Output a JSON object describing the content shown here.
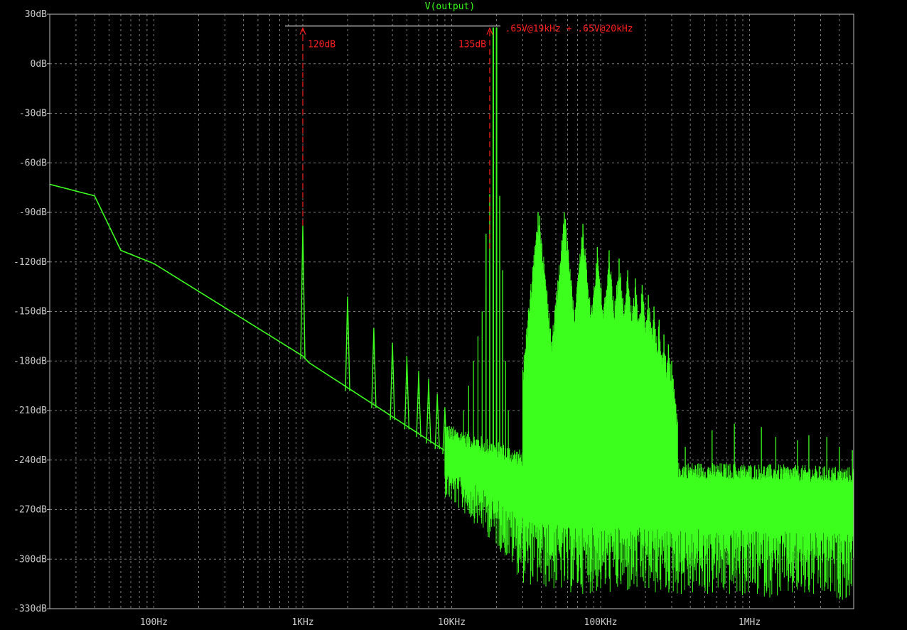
{
  "colors": {
    "background": "#000000",
    "frame": "#bebebe",
    "grid": "#7a7a7a",
    "trace": "#3cff1e",
    "annotation": "#ff2020",
    "title": "#3cff1e",
    "bracket": "#d8d8d8"
  },
  "chart_data": {
    "type": "line",
    "title": "V(output)",
    "xscale": "log",
    "xlim": [
      20,
      5000000
    ],
    "ylim": [
      -330,
      30
    ],
    "grid": true,
    "y_ticks": [
      30,
      0,
      -30,
      -60,
      -90,
      -120,
      -150,
      -180,
      -210,
      -240,
      -270,
      -300,
      -330
    ],
    "y_tick_labels": [
      "30dB",
      "0dB",
      "-30dB",
      "-60dB",
      "-90dB",
      "-120dB",
      "-150dB",
      "-180dB",
      "-210dB",
      "-240dB",
      "-270dB",
      "-300dB",
      "-330dB"
    ],
    "x_ticks": [
      100,
      1000,
      10000,
      100000,
      1000000
    ],
    "x_tick_labels": [
      "100Hz",
      "1KHz",
      "10KHz",
      "100KHz",
      "1MHz"
    ],
    "series": [
      {
        "baseline": [
          [
            20,
            -73
          ],
          [
            40,
            -80
          ],
          [
            60,
            -113
          ],
          [
            100,
            -121
          ],
          [
            1000,
            -177
          ],
          [
            1100,
            -181
          ],
          [
            10000,
            -237
          ],
          [
            30000,
            -252
          ],
          [
            60000,
            -258
          ],
          [
            100000,
            -258
          ],
          [
            1000000,
            -260
          ],
          [
            5000000,
            -262
          ]
        ],
        "carriers": [
          [
            19000,
            22
          ],
          [
            20000,
            22
          ]
        ],
        "harmonic_peaks": [
          [
            1000,
            -98
          ],
          [
            2000,
            -141
          ],
          [
            3000,
            -160
          ],
          [
            4000,
            -169
          ],
          [
            5000,
            -177
          ],
          [
            6000,
            -186
          ],
          [
            7000,
            -191
          ],
          [
            8000,
            -200
          ],
          [
            9000,
            -208
          ]
        ],
        "imd_peaks": [
          [
            17000,
            -103
          ],
          [
            18000,
            -79
          ],
          [
            21000,
            -80
          ],
          [
            22000,
            -125
          ],
          [
            38000,
            -90
          ],
          [
            39000,
            -92
          ],
          [
            57000,
            -90
          ],
          [
            58000,
            -94
          ],
          [
            76000,
            -97
          ],
          [
            95000,
            -111
          ],
          [
            114000,
            -113
          ],
          [
            133000,
            -118
          ],
          [
            152000,
            -125
          ],
          [
            171000,
            -130
          ],
          [
            190000,
            -134
          ],
          [
            209000,
            -140
          ],
          [
            228000,
            -147
          ],
          [
            247000,
            -155
          ],
          [
            266000,
            -164
          ],
          [
            285000,
            -170
          ],
          [
            300000,
            -180
          ]
        ],
        "spurs": [
          [
            370000,
            -232
          ],
          [
            560000,
            -222
          ],
          [
            790000,
            -218
          ],
          [
            1200000,
            -220
          ],
          [
            1500000,
            -226
          ],
          [
            2100000,
            -228
          ],
          [
            2500000,
            -225
          ],
          [
            3300000,
            -226
          ],
          [
            4000000,
            -232
          ],
          [
            4900000,
            -234
          ]
        ]
      }
    ],
    "annotations": [
      {
        "text": "120dB",
        "x": 1000,
        "from": -98,
        "to": 22
      },
      {
        "text": "135dB",
        "x": 18000,
        "from": -112,
        "to": 22
      },
      {
        "text": ".65V@19kHz + .65V@20kHz",
        "x": 20000,
        "y": 22
      }
    ]
  }
}
